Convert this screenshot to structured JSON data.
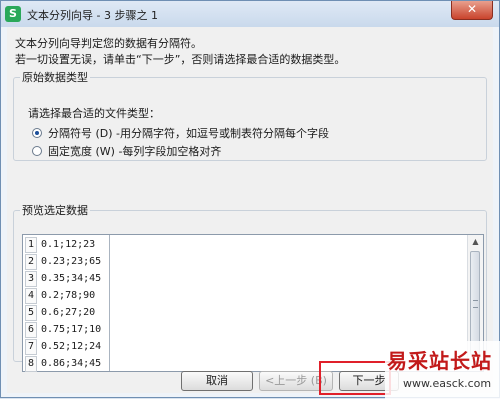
{
  "window": {
    "title": "文本分列向导 - 3 步骤之 1",
    "app_icon_glyph": "S",
    "close_glyph": "✕"
  },
  "intro": {
    "line1": "文本分列向导判定您的数据有分隔符。",
    "line2": "若一切设置无误，请单击“下一步”，否则请选择最合适的数据类型。"
  },
  "original_type": {
    "legend": "原始数据类型",
    "prompt": "请选择最合适的文件类型：",
    "options": [
      {
        "label": "分隔符号 (D)  -用分隔字符，如逗号或制表符分隔每个字段",
        "checked": true
      },
      {
        "label": "固定宽度 (W)  -每列字段加空格对齐",
        "checked": false
      }
    ]
  },
  "preview": {
    "legend": "预览选定数据",
    "rows": [
      {
        "num": "1",
        "text": "0.1;12;23"
      },
      {
        "num": "2",
        "text": "0.23;23;65"
      },
      {
        "num": "3",
        "text": "0.35;34;45"
      },
      {
        "num": "4",
        "text": "0.2;78;90"
      },
      {
        "num": "5",
        "text": "0.6;27;20"
      },
      {
        "num": "6",
        "text": "0.75;17;10"
      },
      {
        "num": "7",
        "text": "0.52;12;24"
      },
      {
        "num": "8",
        "text": "0.86;34;45"
      }
    ]
  },
  "buttons": {
    "cancel": "取消",
    "prev": "<上一步 (B)",
    "next": "下一步"
  },
  "watermark": {
    "title": "易采站长站",
    "url": "www.easck.com"
  },
  "colors": {
    "highlight": "#e0202a",
    "watermark_text": "#c21a1a",
    "app_icon": "#2aa85a"
  }
}
